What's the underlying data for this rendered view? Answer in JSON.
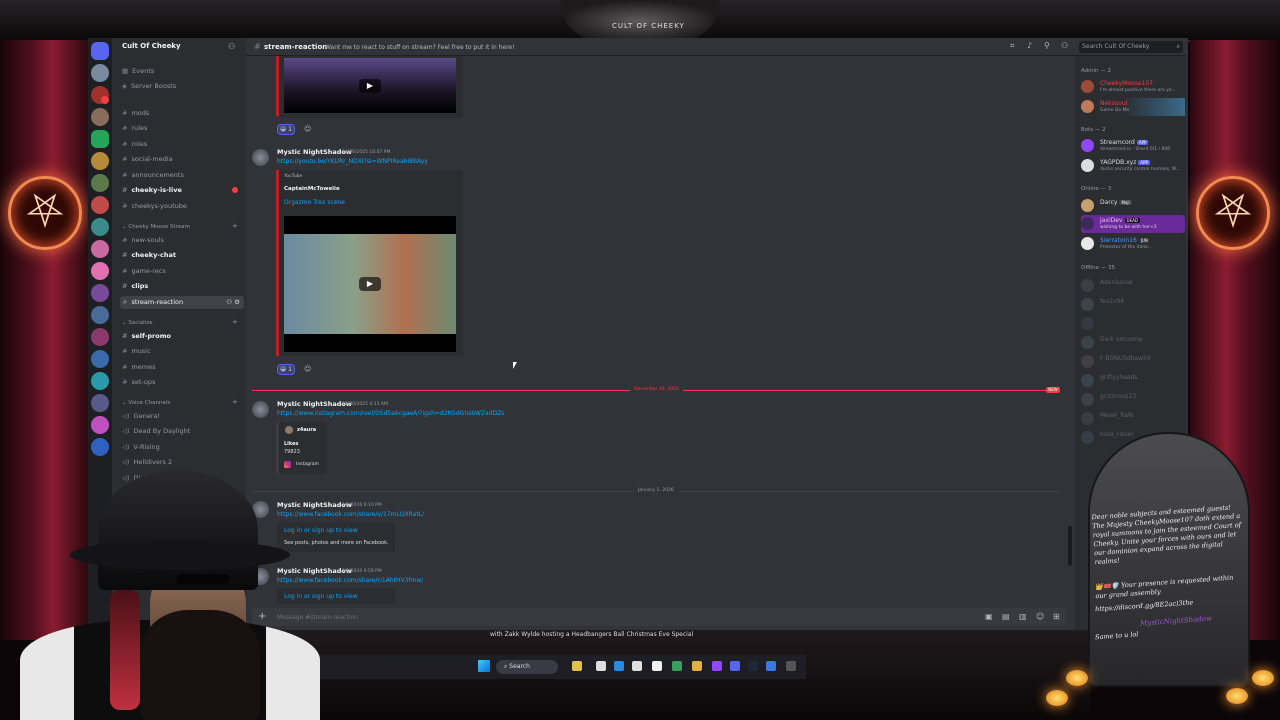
{
  "overlay": {
    "crest_text": "CULT OF CHEEKY",
    "pentagram_glyph": "⛧",
    "marquee": "with Zakk Wylde hosting a Headbangers Ball Christmas Eve Special"
  },
  "server": {
    "name": "Cult Of Cheeky",
    "caret": "⌄"
  },
  "channels": {
    "top": [
      {
        "icon": "calendar-icon",
        "label": "Events"
      },
      {
        "icon": "boost-icon",
        "label": "Server Boosts"
      }
    ],
    "text": [
      "mods",
      "rules",
      "roles",
      "social-media",
      "announcements",
      "cheeky-is-live",
      "cheekys-youtube"
    ],
    "cat_moose": "Cheeky Moose Stream",
    "moose": [
      "new-souls",
      "cheeky-chat",
      "game-recs",
      "clips",
      "stream-reaction"
    ],
    "cat_socialize": "Socialize",
    "socialize": [
      "self-promo",
      "music",
      "memes",
      "set-ups"
    ],
    "cat_voice": "Voice Channels",
    "voice": [
      "General",
      "Dead By Daylight",
      "V-Rising",
      "Helldivers 2",
      "Diablo IV"
    ]
  },
  "header": {
    "hash": "#",
    "channel": "stream-reaction",
    "topic": "Want me to react to stuff on stream? Feel free to put it in here!",
    "search_placeholder": "Search Cult Of Cheeky",
    "search_icon": "⌕"
  },
  "messages": [
    {
      "reaction": "😀 1",
      "add_reaction": "☺"
    },
    {
      "author": "Mystic NightShadow",
      "timestamp": "12/26/2025 10:07 PM",
      "link": "https://youtu.be/YKURr_NDXI?si=WNPIReabi8BAyy",
      "provider": "YouTube",
      "embed_author": "CaptainMcTowelie",
      "embed_title": "Orgazmo Trex scene",
      "reaction": "😀 1",
      "add_reaction": "☺"
    },
    {
      "author": "Mystic NightShadow",
      "timestamp": "12/30/2025 4:13 AM",
      "link": "https://www.instagram.com/reel/DSd5a6cgaeA/?igsh=d2N5dGhsbWZxdDZs",
      "ig_user": "z4aura",
      "ig_likes_label": "Likes",
      "ig_likes": "79823",
      "ig_provider": "Instagram"
    },
    {
      "author": "Mystic NightShadow",
      "timestamp": "1/1/2026 6:10 PM",
      "link": "https://www.facebook.com/share/v/17mLQXRatL/",
      "fb_login": "Log in or sign up to view",
      "fb_desc": "See posts, photos and more on Facebook."
    },
    {
      "author": "Mystic NightShadow",
      "timestamp": "1/1/2026 9:59 PM",
      "link": "https://www.facebook.com/share/r/1AhtHV3fmw/",
      "fb_login": "Log in or sign up to view"
    }
  ],
  "dividers": {
    "dec30": "December 30, 2025",
    "new": "NEW",
    "jan1": "January 1, 2026"
  },
  "composer": {
    "placeholder": "Message #stream-reaction",
    "plus": "+"
  },
  "members": {
    "admin_cat": "Admin — 2",
    "admins": [
      {
        "name": "CheekyMoose107",
        "status": "I'm almost positive there are yo..."
      },
      {
        "name": "Nekosoul",
        "status": "Game Da Me"
      }
    ],
    "bots_cat": "Bots — 2",
    "bots": [
      {
        "name": "Streamcord",
        "tag": "APP",
        "status": "streamcord.io · Shard 0/1 / 800"
      },
      {
        "name": "YAGPDB.xyz",
        "tag": "APP",
        "status": "ducks security control humans, W..."
      }
    ],
    "online_cat": "Online — 3",
    "online": [
      {
        "name": "Darcy",
        "tag": "Maji",
        "status": ""
      },
      {
        "name": "JaxiDev",
        "tag": "DEAD",
        "status": "wishing to be with her<3"
      },
      {
        "name": "Sierratoin16",
        "tag": "JUN",
        "status": "Protector of the Italia..."
      }
    ],
    "offline_cat": "Offline — 35",
    "offline": [
      "Adenbasse",
      "fex2x96",
      "",
      "Dark seruome",
      "F-BONUSdbaw59",
      "griftyyhaads",
      "grizzmezi23",
      "Mesel_Rafe",
      "hsse_raiser"
    ]
  },
  "chat_overlay": {
    "announcement": "Dear noble subjects and esteemed guests! The Majesty CheekyMoose107 doth extend a royal summons to join the esteemed Court of Cheeky. Unite your forces with ours and let our dominion expand across the digital realms!",
    "presence": "Your presence is requested within our grand assembly",
    "invite": "https://discord.gg/8E2ac)3the",
    "chatter_name": "MysticNightShadow",
    "chatter_msg": "Same to u lol"
  },
  "taskbar": {
    "search": "Search"
  },
  "colors": {
    "accent": "#c41c23",
    "link": "#00a8fc",
    "blurple": "#5865f2",
    "bg": "#313338",
    "sidebar": "#2b2d31"
  }
}
